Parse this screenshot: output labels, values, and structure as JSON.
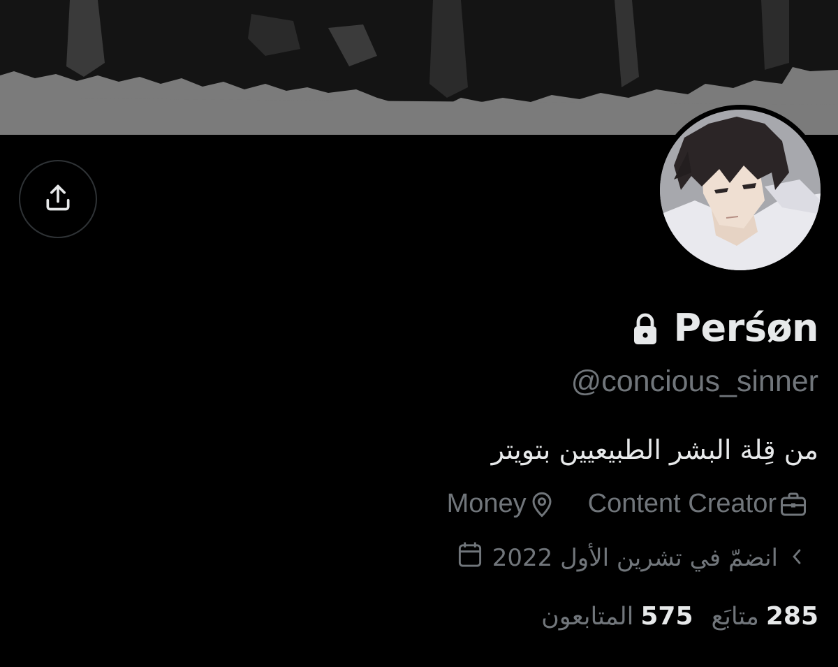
{
  "profile": {
    "name": "Perśøn",
    "handle": "@concious_sinner",
    "bio": "من قِلة البشر الطبيعيين بتويتر",
    "profession": "Content Creator",
    "location": "Money",
    "joined": "انضمّ في تشرين الأول 2022",
    "following_count": "285",
    "following_label": "متابَع",
    "followers_count": "575",
    "followers_label": "المتابعون"
  },
  "icons": {
    "share": "share-icon",
    "lock": "lock-icon",
    "location": "location-pin-icon",
    "profession": "briefcase-icon",
    "calendar": "calendar-icon",
    "chevron": "chevron-left-icon"
  },
  "colors": {
    "background": "#000000",
    "primary_text": "#e7e9ea",
    "secondary_text": "#71767b",
    "banner": "#7a7a7a",
    "border": "#2f3336"
  }
}
